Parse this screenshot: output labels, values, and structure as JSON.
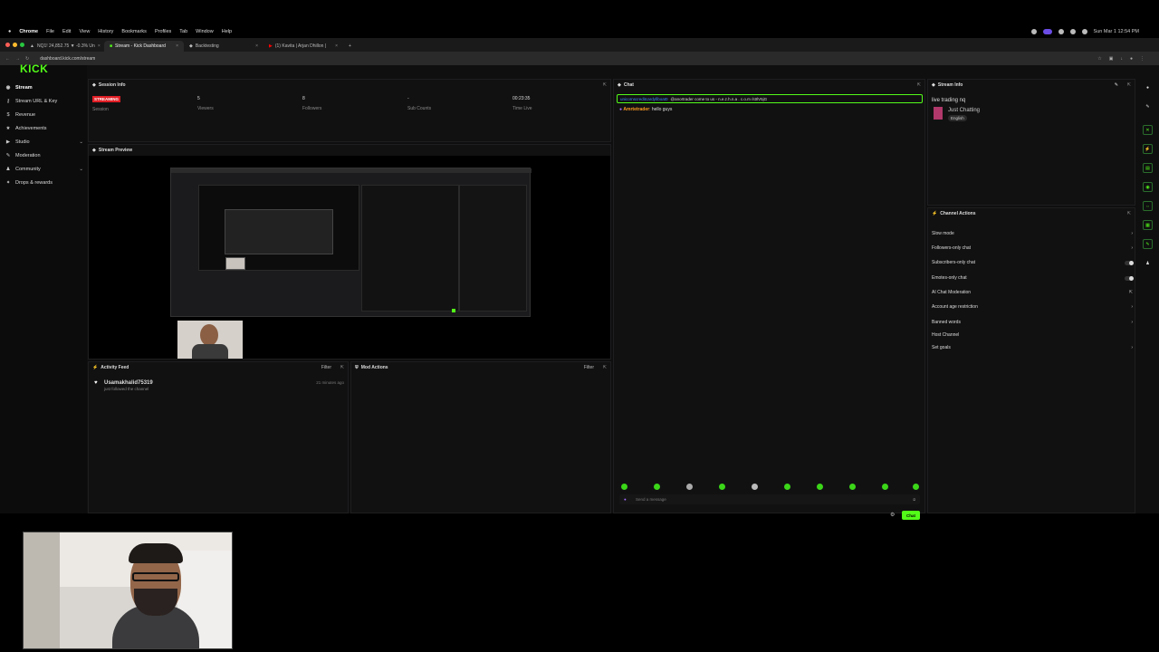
{
  "menubar": {
    "app": "Chrome",
    "items": [
      "File",
      "Edit",
      "View",
      "History",
      "Bookmarks",
      "Profiles",
      "Tab",
      "Window",
      "Help"
    ],
    "datetime": "Sun Mar 1 12:54 PM"
  },
  "tabs": [
    {
      "label": "NQ1! 24,852.75 ▼ -0.3% Un",
      "active": false
    },
    {
      "label": "Stream - Kick Dashboard",
      "active": true
    },
    {
      "label": "Backtesting",
      "active": false
    },
    {
      "label": "(1) Kavita | Arjan Dhillon |",
      "active": false
    }
  ],
  "address": {
    "url": "dashboard.kick.com/stream"
  },
  "sidebar": {
    "logo": "KICK",
    "items": [
      {
        "label": "Stream",
        "icon": "broadcast-icon",
        "chev": ""
      },
      {
        "label": "Stream URL & Key",
        "icon": "key-icon",
        "chev": ""
      },
      {
        "label": "Revenue",
        "icon": "dollar-icon",
        "chev": ""
      },
      {
        "label": "Achievements",
        "icon": "trophy-icon",
        "chev": ""
      },
      {
        "label": "Studio",
        "icon": "video-icon",
        "chev": "⌄"
      },
      {
        "label": "Moderation",
        "icon": "wrench-icon",
        "chev": ""
      },
      {
        "label": "Community",
        "icon": "users-icon",
        "chev": "⌄"
      },
      {
        "label": "Drops & rewards",
        "icon": "gift-icon",
        "chev": ""
      }
    ]
  },
  "session": {
    "title": "Session Info",
    "status_badge": "STREAMING",
    "status_label": "Session",
    "viewers": "5",
    "viewers_label": "Viewers",
    "followers": "8",
    "followers_label": "Followers",
    "subs": "-",
    "subs_label": "Sub Counts",
    "time_live": "00:23:35",
    "time_label": "Time Live"
  },
  "preview": {
    "title": "Stream Preview"
  },
  "activity": {
    "title": "Activity Feed",
    "filter": "Filter",
    "items": [
      {
        "user": "Usamakhalid75319",
        "text": "just followed the channel",
        "time": "21 minutes ago"
      }
    ]
  },
  "mod_actions": {
    "title": "Mod Actions",
    "filter": "Filter"
  },
  "chat": {
    "title": "Chat",
    "pinned_user": "unicornscreditcardyfiboat0",
    "pinned_text": "@anortrader come to us - n.e.z.h.n.a . c.o.m /stIlV5jG",
    "messages": [
      {
        "user": "Amrtetrader",
        "text": "hello guys",
        "color": "#ff9a1f"
      }
    ],
    "input_placeholder": "Send a message",
    "send_label": "Chat"
  },
  "stream_info": {
    "title": "Stream Info",
    "stream_title": "live trading nq",
    "category": "Just Chatting",
    "language": "English"
  },
  "channel_actions": {
    "title": "Channel Actions",
    "items": [
      {
        "label": "Slow mode",
        "control": "chevron"
      },
      {
        "label": "Followers-only chat",
        "control": "chevron"
      },
      {
        "label": "Subscribers-only chat",
        "control": "toggle"
      },
      {
        "label": "Emotes-only chat",
        "control": "toggle"
      },
      {
        "label": "AI Chat Moderation",
        "control": "external"
      },
      {
        "label": "Account age restriction",
        "control": "chevron"
      },
      {
        "label": "Banned words",
        "control": "chevron"
      },
      {
        "label": "Host Channel",
        "control": "none"
      },
      {
        "label": "Set goals",
        "control": "chevron"
      }
    ]
  },
  "colors": {
    "brand": "#53fc18",
    "live": "#e01e25"
  }
}
